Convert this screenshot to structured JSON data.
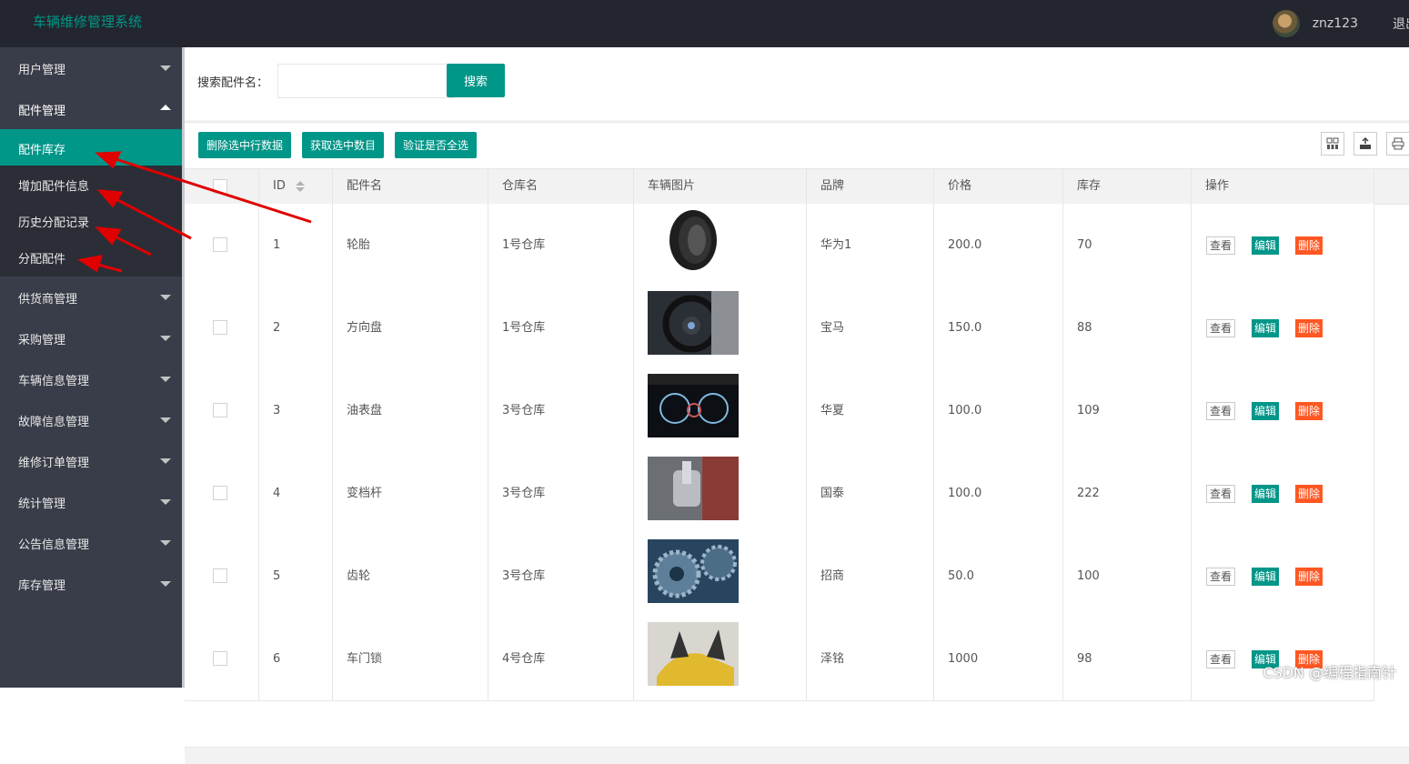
{
  "header": {
    "app_title": "车辆维修管理系统",
    "username": "znz123",
    "logout_label": "退出"
  },
  "sidebar": {
    "items": [
      {
        "label": "用户管理",
        "expanded": false
      },
      {
        "label": "配件管理",
        "expanded": true,
        "children": [
          {
            "label": "配件库存",
            "active": true
          },
          {
            "label": "增加配件信息",
            "active": false
          },
          {
            "label": "历史分配记录",
            "active": false
          },
          {
            "label": "分配配件",
            "active": false
          }
        ]
      },
      {
        "label": "供货商管理",
        "expanded": false
      },
      {
        "label": "采购管理",
        "expanded": false
      },
      {
        "label": "车辆信息管理",
        "expanded": false
      },
      {
        "label": "故障信息管理",
        "expanded": false
      },
      {
        "label": "维修订单管理",
        "expanded": false
      },
      {
        "label": "统计管理",
        "expanded": false
      },
      {
        "label": "公告信息管理",
        "expanded": false
      },
      {
        "label": "库存管理",
        "expanded": false
      }
    ]
  },
  "search": {
    "label": "搜索配件名：",
    "value": "",
    "button": "搜索"
  },
  "toolbar": {
    "delete_selected": "删除选中行数据",
    "get_count": "获取选中数目",
    "check_all": "验证是否全选",
    "icons": [
      "columns-icon",
      "export-icon",
      "print-icon"
    ]
  },
  "table": {
    "columns": [
      "",
      "ID",
      "配件名",
      "仓库名",
      "车辆图片",
      "品牌",
      "价格",
      "库存",
      "操作"
    ],
    "rows": [
      {
        "id": "1",
        "name": "轮胎",
        "warehouse": "1号仓库",
        "image": "tire-image",
        "brand": "华为1",
        "price": "200.0",
        "stock": "70"
      },
      {
        "id": "2",
        "name": "方向盘",
        "warehouse": "1号仓库",
        "image": "steering-wheel-image",
        "brand": "宝马",
        "price": "150.0",
        "stock": "88"
      },
      {
        "id": "3",
        "name": "油表盘",
        "warehouse": "3号仓库",
        "image": "dashboard-image",
        "brand": "华夏",
        "price": "100.0",
        "stock": "109"
      },
      {
        "id": "4",
        "name": "变档杆",
        "warehouse": "3号仓库",
        "image": "gear-shift-image",
        "brand": "国泰",
        "price": "100.0",
        "stock": "222"
      },
      {
        "id": "5",
        "name": "齿轮",
        "warehouse": "3号仓库",
        "image": "gears-image",
        "brand": "招商",
        "price": "50.0",
        "stock": "100"
      },
      {
        "id": "6",
        "name": "车门锁",
        "warehouse": "4号仓库",
        "image": "car-door-image",
        "brand": "泽铭",
        "price": "1000",
        "stock": "98"
      }
    ],
    "actions": {
      "view": "查看",
      "edit": "编辑",
      "delete": "删除"
    }
  },
  "watermark": "CSDN @编程指南针",
  "colors": {
    "header_bg": "#23262e",
    "sidebar_bg": "#393d49",
    "submenu_bg": "#2b2e37",
    "accent": "#009688",
    "danger": "#ff5722",
    "arrow": "#e00000"
  }
}
